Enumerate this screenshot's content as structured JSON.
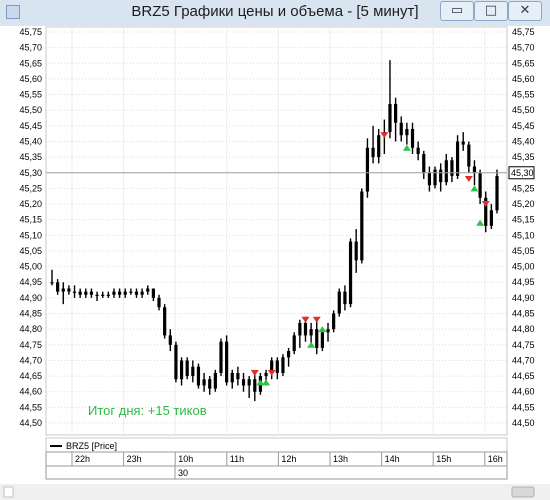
{
  "window": {
    "title": "BRZ5 Графики цены и объема - [5 минут]",
    "buttons": {
      "minimize": "▭",
      "maximize": "□",
      "close": "✕"
    }
  },
  "chart_data": {
    "type": "ohlc",
    "symbol": "BRZ5",
    "legend": "BRZ5 [Price]",
    "y_ticks": [
      "45,75",
      "45,70",
      "45,65",
      "45,60",
      "45,55",
      "45,50",
      "45,45",
      "45,40",
      "45,35",
      "45,30",
      "45,25",
      "45,20",
      "45,15",
      "45,10",
      "45,05",
      "45,00",
      "44,95",
      "44,90",
      "44,85",
      "44,80",
      "44,75",
      "44,70",
      "44,65",
      "44,60",
      "44,55",
      "44,50"
    ],
    "ylim": [
      44.5,
      45.75
    ],
    "current_price": 45.3,
    "current_price_label": "45,30",
    "x_ticks": [
      "22h",
      "23h",
      "10h",
      "11h",
      "12h",
      "13h",
      "14h",
      "15h",
      "16h"
    ],
    "date_label": "30",
    "annotation": "Итог дня: +15 тиков",
    "colors": {
      "bars": "#000000",
      "sell": "#e0302a",
      "buy": "#2ec24a",
      "annotation": "#2fba4a",
      "grid": "#dcdcdc"
    },
    "bars": [
      [
        44.95,
        44.99,
        44.94,
        44.95
      ],
      [
        44.95,
        44.96,
        44.91,
        44.92
      ],
      [
        44.92,
        44.95,
        44.88,
        44.93
      ],
      [
        44.93,
        44.94,
        44.91,
        44.92
      ],
      [
        44.92,
        44.94,
        44.9,
        44.92
      ],
      [
        44.92,
        44.93,
        44.9,
        44.91
      ],
      [
        44.91,
        44.93,
        44.9,
        44.92
      ],
      [
        44.92,
        44.93,
        44.9,
        44.91
      ],
      [
        44.91,
        44.92,
        44.89,
        44.91
      ],
      [
        44.91,
        44.92,
        44.9,
        44.91
      ],
      [
        44.91,
        44.92,
        44.9,
        44.91
      ],
      [
        44.91,
        44.93,
        44.9,
        44.92
      ],
      [
        44.92,
        44.93,
        44.9,
        44.91
      ],
      [
        44.91,
        44.93,
        44.9,
        44.92
      ],
      [
        44.92,
        44.93,
        44.91,
        44.92
      ],
      [
        44.92,
        44.93,
        44.9,
        44.91
      ],
      [
        44.91,
        44.93,
        44.9,
        44.92
      ],
      [
        44.92,
        44.94,
        44.91,
        44.93
      ],
      [
        44.93,
        44.93,
        44.89,
        44.9
      ],
      [
        44.9,
        44.91,
        44.86,
        44.87
      ],
      [
        44.87,
        44.88,
        44.77,
        44.78
      ],
      [
        44.78,
        44.8,
        44.73,
        44.75
      ],
      [
        44.75,
        44.76,
        44.63,
        44.64
      ],
      [
        44.64,
        44.71,
        44.62,
        44.7
      ],
      [
        44.7,
        44.71,
        44.64,
        44.65
      ],
      [
        44.65,
        44.7,
        44.63,
        44.68
      ],
      [
        44.68,
        44.69,
        44.61,
        44.62
      ],
      [
        44.62,
        44.66,
        44.6,
        44.64
      ],
      [
        44.64,
        44.65,
        44.59,
        44.61
      ],
      [
        44.61,
        44.67,
        44.6,
        44.66
      ],
      [
        44.66,
        44.77,
        44.65,
        44.76
      ],
      [
        44.76,
        44.78,
        44.62,
        44.63
      ],
      [
        44.63,
        44.67,
        44.61,
        44.66
      ],
      [
        44.66,
        44.68,
        44.62,
        44.64
      ],
      [
        44.64,
        44.66,
        44.6,
        44.62
      ],
      [
        44.62,
        44.65,
        44.58,
        44.64
      ],
      [
        44.64,
        44.66,
        44.57,
        44.6
      ],
      [
        44.6,
        44.66,
        44.59,
        44.65
      ],
      [
        44.65,
        44.67,
        44.62,
        44.66
      ],
      [
        44.66,
        44.71,
        44.64,
        44.7
      ],
      [
        44.7,
        44.71,
        44.64,
        44.66
      ],
      [
        44.66,
        44.72,
        44.65,
        44.71
      ],
      [
        44.71,
        44.74,
        44.68,
        44.73
      ],
      [
        44.73,
        44.79,
        44.72,
        44.78
      ],
      [
        44.78,
        44.83,
        44.74,
        44.82
      ],
      [
        44.82,
        44.84,
        44.76,
        44.78
      ],
      [
        44.78,
        44.82,
        44.75,
        44.8
      ],
      [
        44.8,
        44.83,
        44.72,
        44.74
      ],
      [
        44.74,
        44.8,
        44.73,
        44.79
      ],
      [
        44.79,
        44.82,
        44.76,
        44.8
      ],
      [
        44.8,
        44.86,
        44.79,
        44.85
      ],
      [
        44.85,
        44.93,
        44.84,
        44.92
      ],
      [
        44.92,
        44.94,
        44.86,
        44.88
      ],
      [
        44.88,
        45.09,
        44.87,
        45.08
      ],
      [
        45.08,
        45.12,
        44.98,
        45.02
      ],
      [
        45.02,
        45.25,
        45.01,
        45.24
      ],
      [
        45.24,
        45.41,
        45.22,
        45.38
      ],
      [
        45.38,
        45.45,
        45.33,
        45.35
      ],
      [
        45.35,
        45.44,
        45.33,
        45.42
      ],
      [
        45.42,
        45.47,
        45.36,
        45.43
      ],
      [
        45.43,
        45.66,
        45.41,
        45.52
      ],
      [
        45.52,
        45.54,
        45.4,
        45.46
      ],
      [
        45.46,
        45.48,
        45.4,
        45.42
      ],
      [
        45.42,
        45.46,
        45.39,
        45.44
      ],
      [
        45.44,
        45.46,
        45.36,
        45.38
      ],
      [
        45.38,
        45.4,
        45.34,
        45.36
      ],
      [
        45.36,
        45.37,
        45.28,
        45.3
      ],
      [
        45.3,
        45.32,
        45.24,
        45.26
      ],
      [
        45.26,
        45.32,
        45.25,
        45.31
      ],
      [
        45.31,
        45.33,
        45.24,
        45.27
      ],
      [
        45.27,
        45.36,
        45.26,
        45.34
      ],
      [
        45.34,
        45.35,
        45.27,
        45.29
      ],
      [
        45.29,
        45.42,
        45.28,
        45.4
      ],
      [
        45.4,
        45.43,
        45.37,
        45.39
      ],
      [
        45.39,
        45.4,
        45.3,
        45.32
      ],
      [
        45.32,
        45.34,
        45.26,
        45.3
      ],
      [
        45.3,
        45.31,
        45.2,
        45.22
      ],
      [
        45.22,
        45.24,
        45.11,
        45.13
      ],
      [
        45.13,
        45.2,
        45.12,
        45.18
      ],
      [
        45.18,
        45.31,
        45.17,
        45.29
      ]
    ],
    "markers": [
      {
        "bar": 59,
        "type": "sell",
        "price": 45.42
      },
      {
        "bar": 63,
        "type": "buy",
        "price": 45.38
      },
      {
        "bar": 36,
        "type": "sell",
        "price": 44.66
      },
      {
        "bar": 37,
        "type": "buy",
        "price": 44.63
      },
      {
        "bar": 38,
        "type": "buy",
        "price": 44.63
      },
      {
        "bar": 39,
        "type": "sell",
        "price": 44.66
      },
      {
        "bar": 45,
        "type": "sell",
        "price": 44.83
      },
      {
        "bar": 46,
        "type": "buy",
        "price": 44.75
      },
      {
        "bar": 47,
        "type": "sell",
        "price": 44.83
      },
      {
        "bar": 48,
        "type": "buy",
        "price": 44.8
      },
      {
        "bar": 74,
        "type": "sell",
        "price": 45.28
      },
      {
        "bar": 75,
        "type": "buy",
        "price": 45.25
      },
      {
        "bar": 76,
        "type": "buy",
        "price": 45.14
      },
      {
        "bar": 77,
        "type": "sell",
        "price": 45.2
      }
    ]
  }
}
